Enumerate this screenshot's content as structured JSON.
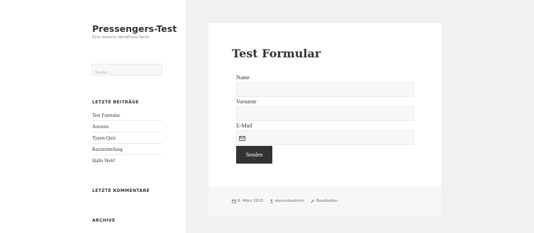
{
  "site": {
    "title": "Pressengers-Test",
    "description": "Eine weitere WordPress-Seite"
  },
  "search": {
    "placeholder": "Suche …"
  },
  "widgets": {
    "recent_posts_title": "LETZTE BEITRÄGE",
    "recent_posts": [
      "Test Formular",
      "Autoren",
      "Typen-Quiz",
      "Kurzmitteilung",
      "Hallo Welt!"
    ],
    "recent_comments_title": "LETZTE KOMMENTARE",
    "archive_title": "ARCHIVE"
  },
  "entry": {
    "title": "Test Formular",
    "form": {
      "name_label": "Name",
      "vorname_label": "Vorname",
      "email_label": "E-Mail",
      "submit_label": "Senden"
    },
    "footer": {
      "date": "9. März 2015",
      "author": "dercooleadmin",
      "edit": "Bearbeiten"
    }
  },
  "icons": {
    "email_field": "envelope-icon",
    "date": "calendar-icon",
    "author": "person-icon",
    "edit": "pencil-icon"
  }
}
